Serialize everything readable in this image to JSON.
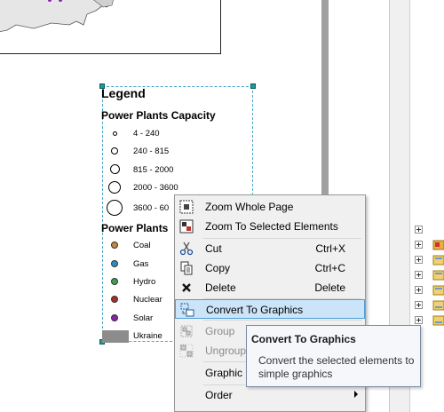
{
  "legend": {
    "title": "Legend",
    "capacity_heading": "Power Plants Capacity",
    "capacity_items": [
      "4 - 240",
      "240 - 815",
      "815 - 2000",
      "2000 - 3600",
      "3600 - 60"
    ],
    "type_heading": "Power Plants",
    "type_items": [
      {
        "label": "Coal",
        "color": "#c9843c"
      },
      {
        "label": "Gas",
        "color": "#2a8fc0"
      },
      {
        "label": "Hydro",
        "color": "#3aa055"
      },
      {
        "label": "Nuclear",
        "color": "#b02a2a"
      },
      {
        "label": "Solar",
        "color": "#8b22a8"
      }
    ],
    "area_item": "Ukraine"
  },
  "context_menu": {
    "items": [
      {
        "label": "Zoom Whole Page",
        "icon": "zoom-whole-page-icon"
      },
      {
        "label": "Zoom To Selected Elements",
        "icon": "zoom-selected-icon"
      },
      {
        "label": "Cut",
        "shortcut": "Ctrl+X",
        "icon": "scissors-icon"
      },
      {
        "label": "Copy",
        "shortcut": "Ctrl+C",
        "icon": "copy-icon"
      },
      {
        "label": "Delete",
        "shortcut": "Delete",
        "icon": "delete-x-icon"
      },
      {
        "label": "Convert To Graphics",
        "icon": "convert-graphics-icon",
        "highlighted": true
      },
      {
        "label": "Group",
        "icon": "group-icon",
        "disabled": true
      },
      {
        "label": "Ungroup",
        "icon": "ungroup-icon",
        "disabled": true
      },
      {
        "label": "Graphic O",
        "icon": ""
      },
      {
        "label": "Order",
        "icon": "",
        "submenu": true
      }
    ]
  },
  "tooltip": {
    "title": "Convert To Graphics",
    "body": "Convert the selected elements to simple graphics"
  },
  "colors": {
    "highlight": "#cce4f7",
    "selection": "#4aa8c8",
    "ukraine_fill": "#8c8c8c"
  }
}
